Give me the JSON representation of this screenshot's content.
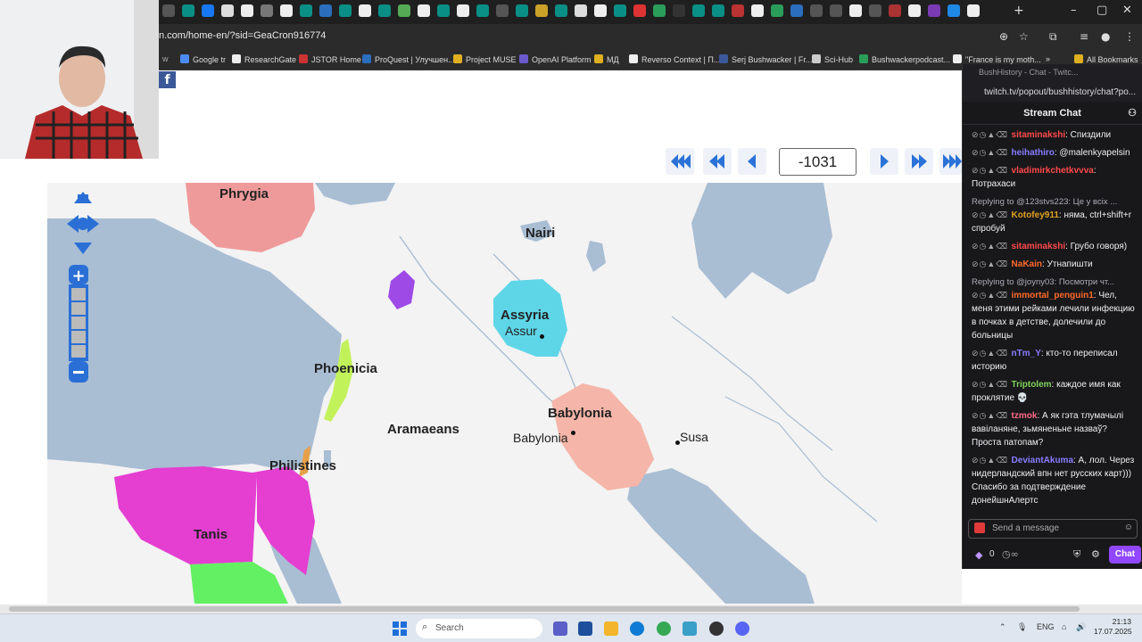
{
  "browser": {
    "url": "n.com/home-en/?sid=GeaCron916774",
    "bookmarks": [
      "Google tr",
      "ResearchGate",
      "JSTOR Home",
      "ProQuest | Улучшен...",
      "Project MUSE",
      "OpenAI Platform",
      "МД",
      "Reverso Context | П...",
      "Serj Bushwacker | Fr...",
      "Sci-Hub",
      "Bushwackerpodcast...",
      "\"France is my moth...",
      "All Bookmarks"
    ]
  },
  "timeline": {
    "year": "-1031"
  },
  "map": {
    "regions": [
      "Phrygia",
      "Nairi",
      "Assyria",
      "Phoenicia",
      "Aramaeans",
      "Babylonia",
      "Philistines",
      "Tanis"
    ],
    "cities": [
      "Assur",
      "Babylonia",
      "Susa"
    ],
    "colors": {
      "phrygia": "#ef9a9a",
      "assyria": "#5ed6e8",
      "babylonia": "#f5b5a8",
      "tanis": "#e43fd0",
      "green": "#63f063",
      "purple": "#9d4ae6",
      "phoenicia": "#c2f25a",
      "philistines": "#e8a048",
      "water": "#a9bdd3"
    }
  },
  "chat": {
    "window_title": "BushHistory - Chat - Twitc...",
    "url": "twitch.tv/popout/bushhistory/chat?po...",
    "header": "Stream Chat",
    "messages": [
      {
        "reply": "",
        "user": "sitaminakshi",
        "color": "#ff4a4a",
        "text": ": Спиздили"
      },
      {
        "reply": "",
        "user": "heihathiro",
        "color": "#8a7cff",
        "text": ": @malenkyapelsin"
      },
      {
        "reply": "",
        "user": "vladimirkchetkvvva",
        "color": "#ff4a4a",
        "text": ": Потрахаси"
      },
      {
        "reply": "Replying to @123stvs223: Це у всіх ...",
        "user": "Kotofey911",
        "color": "#e0a020",
        "text": ": няма, ctrl+shift+r спробуй"
      },
      {
        "reply": "",
        "user": "sitaminakshi",
        "color": "#ff4a4a",
        "text": ": Грубо говоря)"
      },
      {
        "reply": "",
        "user": "NaKain",
        "color": "#ff6a2a",
        "text": ": Утнапишти"
      },
      {
        "reply": "Replying to @joyny03: Посмотри чт...",
        "user": "immortal_penguin1",
        "color": "#ff6a2a",
        "text": ": Чел, меня этими рейками лечили инфекцию в почках в детстве, долечили до больницы"
      },
      {
        "reply": "",
        "user": "nTm_Y",
        "color": "#8a7cff",
        "text": ": кто-то переписал историю"
      },
      {
        "reply": "",
        "user": "Triptolem",
        "color": "#7fd35a",
        "text": ": каждое имя как проклятие 💀"
      },
      {
        "reply": "",
        "user": "tzmok",
        "color": "#ff6a8a",
        "text": ": А як гэта тлумачылі вавіланяне, зьмяненьне назваў? Проста патопам?"
      },
      {
        "reply": "",
        "user": "DeviantAkuma",
        "color": "#8a7cff",
        "text": ": А, лол. Через нидерландский впн нет русских карт))) Спасибо за подтверждение донейшнАлертс"
      }
    ],
    "input_placeholder": "Send a message",
    "points": "0",
    "chat_button": "Chat"
  },
  "taskbar": {
    "search": "Search",
    "lang": "ENG",
    "time": "21:13",
    "date": "17.07.2025"
  }
}
